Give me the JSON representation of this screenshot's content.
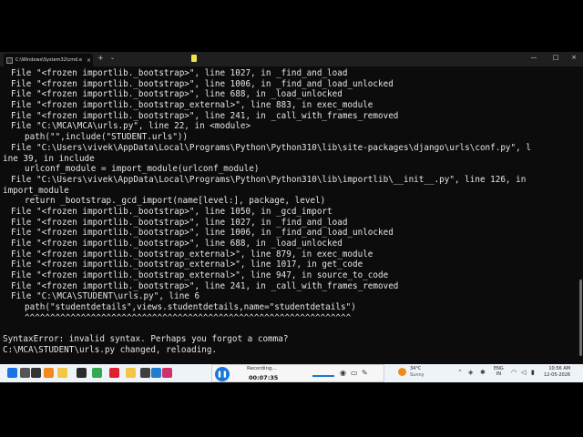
{
  "window": {
    "tab_title": "C:\\Windows\\System32\\cmd.e",
    "tab_close": "×",
    "new_tab": "+",
    "dropdown": "⌄",
    "minimize": "—",
    "maximize": "□",
    "close": "×"
  },
  "terminal_lines": [
    {
      "indent": 1,
      "text": "File \"<frozen importlib._bootstrap>\", line 1027, in _find_and_load"
    },
    {
      "indent": 1,
      "text": "File \"<frozen importlib._bootstrap>\", line 1006, in _find_and_load_unlocked"
    },
    {
      "indent": 1,
      "text": "File \"<frozen importlib._bootstrap>\", line 688, in _load_unlocked"
    },
    {
      "indent": 1,
      "text": "File \"<frozen importlib._bootstrap_external>\", line 883, in exec_module"
    },
    {
      "indent": 1,
      "text": "File \"<frozen importlib._bootstrap>\", line 241, in _call_with_frames_removed"
    },
    {
      "indent": 1,
      "text": "File \"C:\\MCA\\MCA\\urls.py\", line 22, in <module>"
    },
    {
      "indent": 2,
      "text": "path(\"\",include(\"STUDENT.urls\"))"
    },
    {
      "indent": 1,
      "text": "File \"C:\\Users\\vivek\\AppData\\Local\\Programs\\Python\\Python310\\lib\\site-packages\\django\\urls\\conf.py\", l"
    },
    {
      "indent": 0,
      "text": "ine 39, in include"
    },
    {
      "indent": 2,
      "text": "urlconf_module = import_module(urlconf_module)"
    },
    {
      "indent": 1,
      "text": "File \"C:\\Users\\vivek\\AppData\\Local\\Programs\\Python\\Python310\\lib\\importlib\\__init__.py\", line 126, in"
    },
    {
      "indent": 0,
      "text": "import_module"
    },
    {
      "indent": 2,
      "text": "return _bootstrap._gcd_import(name[level:], package, level)"
    },
    {
      "indent": 1,
      "text": "File \"<frozen importlib._bootstrap>\", line 1050, in _gcd_import"
    },
    {
      "indent": 1,
      "text": "File \"<frozen importlib._bootstrap>\", line 1027, in _find_and_load"
    },
    {
      "indent": 1,
      "text": "File \"<frozen importlib._bootstrap>\", line 1006, in _find_and_load_unlocked"
    },
    {
      "indent": 1,
      "text": "File \"<frozen importlib._bootstrap>\", line 688, in _load_unlocked"
    },
    {
      "indent": 1,
      "text": "File \"<frozen importlib._bootstrap_external>\", line 879, in exec_module"
    },
    {
      "indent": 1,
      "text": "File \"<frozen importlib._bootstrap_external>\", line 1017, in get_code"
    },
    {
      "indent": 1,
      "text": "File \"<frozen importlib._bootstrap_external>\", line 947, in source_to_code"
    },
    {
      "indent": 1,
      "text": "File \"<frozen importlib._bootstrap>\", line 241, in _call_with_frames_removed"
    },
    {
      "indent": 1,
      "text": "File \"C:\\MCA\\STUDENT\\urls.py\", line 6"
    },
    {
      "indent": 2,
      "text": "path(\"studentdetails\",views.studentdetails,name=\"studentdetails\")"
    },
    {
      "indent": 2,
      "text": "^^^^^^^^^^^^^^^^^^^^^^^^^^^^^^^^^^^^^^^^^^^^^^^^^^^^^^^^^^^^^^^^"
    },
    {
      "indent": 0,
      "text": ""
    },
    {
      "indent": 0,
      "text": "SyntaxError: invalid syntax. Perhaps you forgot a comma?"
    },
    {
      "indent": 0,
      "text": "C:\\MCA\\STUDENT\\urls.py changed, reloading."
    }
  ],
  "taskbar": {
    "recording_label": "Recording...",
    "recording_time": "00:07:35",
    "pause_symbol": "❚❚",
    "weather_temp": "34°C",
    "weather_desc": "Sunny",
    "lang_line1": "ENG",
    "lang_line2": "IN",
    "time": "10:56 AM",
    "date": "12-05-2026",
    "apps": [
      {
        "name": "start-icon",
        "color": "#1a73e8"
      },
      {
        "name": "search-icon",
        "color": "#555555"
      },
      {
        "name": "task-view-icon",
        "color": "#333333"
      },
      {
        "name": "sublime-icon",
        "color": "#f08a1c"
      },
      {
        "name": "files-icon",
        "color": "#f2c744"
      },
      {
        "name": "terminal-icon",
        "color": "#2b2b2b"
      },
      {
        "name": "chrome-icon",
        "color": "#34a853"
      },
      {
        "name": "opera-icon",
        "color": "#e0202f"
      },
      {
        "name": "explorer-icon",
        "color": "#f4c542"
      },
      {
        "name": "cmd-icon",
        "color": "#404040"
      },
      {
        "name": "edge-icon",
        "color": "#1e7fd0"
      },
      {
        "name": "vpn-icon",
        "color": "#d0306a"
      }
    ]
  }
}
